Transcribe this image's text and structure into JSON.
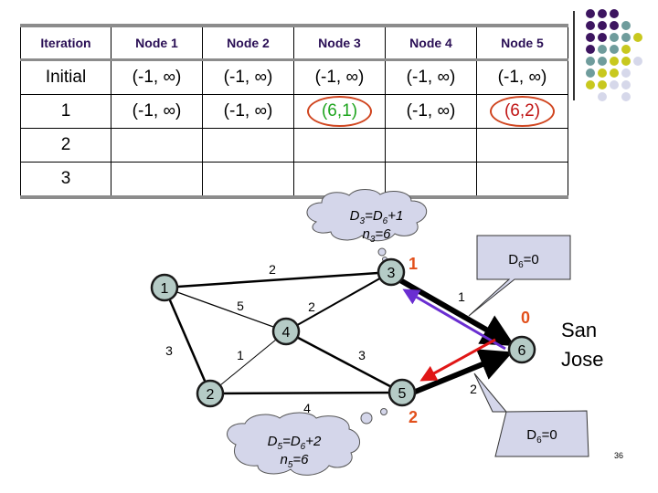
{
  "table": {
    "headers": [
      "Iteration",
      "Node 1",
      "Node 2",
      "Node 3",
      "Node 4",
      "Node 5"
    ],
    "rows": [
      [
        "Initial",
        "(-1, ∞)",
        "(-1, ∞)",
        "(-1, ∞)",
        "(-1, ∞)",
        "(-1, ∞)"
      ],
      [
        "1",
        "(-1, ∞)",
        "(-1, ∞)",
        "(6,1)",
        "(-1, ∞)",
        "(6,2)"
      ],
      [
        "2",
        "",
        "",
        "",
        "",
        ""
      ],
      [
        "3",
        "",
        "",
        "",
        "",
        ""
      ]
    ],
    "highlighted": [
      {
        "row": 1,
        "col": 3,
        "color": "#1fa51f"
      },
      {
        "row": 1,
        "col": 5,
        "color": "#c01414"
      }
    ]
  },
  "graph": {
    "nodes": [
      {
        "id": "1",
        "label": "1"
      },
      {
        "id": "2",
        "label": "2"
      },
      {
        "id": "3",
        "label": "3",
        "distance": "1"
      },
      {
        "id": "4",
        "label": "4"
      },
      {
        "id": "5",
        "label": "5",
        "distance": "2"
      },
      {
        "id": "6",
        "label": "6",
        "distance": "0"
      }
    ],
    "edges": [
      {
        "from": "1",
        "to": "3",
        "weight": "2"
      },
      {
        "from": "1",
        "to": "4",
        "weight": "5"
      },
      {
        "from": "1",
        "to": "2",
        "weight": "3"
      },
      {
        "from": "4",
        "to": "3",
        "weight": "2"
      },
      {
        "from": "2",
        "to": "4",
        "weight": "1"
      },
      {
        "from": "4",
        "to": "5",
        "weight": "3"
      },
      {
        "from": "2",
        "to": "5",
        "weight": "4"
      },
      {
        "from": "3",
        "to": "6",
        "weight": "1"
      },
      {
        "from": "5",
        "to": "6",
        "weight": "2"
      }
    ],
    "destination_label": [
      "San",
      "Jose"
    ]
  },
  "callouts": {
    "d3_line1": "D3=D6+1",
    "d3_line2": "n3=6",
    "d5_line1": "D5=D6+2",
    "d5_line2": "n5=6",
    "d6_top": "D6=0",
    "d6_bottom": "D6=0"
  },
  "colors": {
    "node_fill": "#b5cbc6",
    "cloud_fill": "#d4d6ea",
    "callout_fill": "#d4d6ea",
    "distance_label": "#e2501c",
    "update_arrow_3": "#6a2ed1",
    "update_arrow_5": "#e01616"
  },
  "slide_number": "36"
}
